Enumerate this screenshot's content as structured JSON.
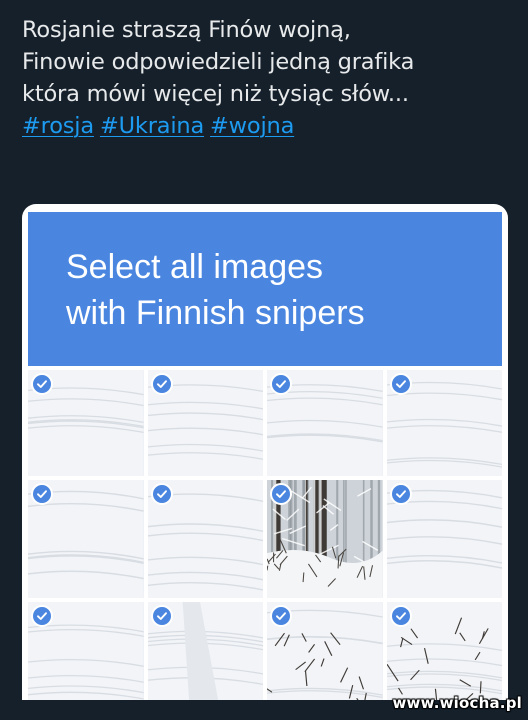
{
  "tweet": {
    "lines": [
      "Rosjanie straszą Finów wojną,",
      "Finowie odpowiedzieli jedną grafika",
      "która mówi więcej niż tysiąc słów..."
    ],
    "hashtags": [
      "#rosja",
      "#Ukraina",
      "#wojna"
    ],
    "link_color": "#1d9bf0"
  },
  "captcha": {
    "title_lines": [
      "Select all images",
      "with Finnish snipers"
    ],
    "header_color": "#4a86e0",
    "tiles": [
      {
        "row": 1,
        "col": 1,
        "scene": "snowy-forest",
        "selected": true
      },
      {
        "row": 1,
        "col": 2,
        "scene": "snowy-forest",
        "selected": true
      },
      {
        "row": 1,
        "col": 3,
        "scene": "snowy-forest",
        "selected": true
      },
      {
        "row": 1,
        "col": 4,
        "scene": "snowy-forest",
        "selected": true
      },
      {
        "row": 2,
        "col": 1,
        "scene": "snowy-forest-edge",
        "selected": true
      },
      {
        "row": 2,
        "col": 2,
        "scene": "snowy-forest-path",
        "selected": true
      },
      {
        "row": 2,
        "col": 3,
        "scene": "snowy-brush",
        "selected": true
      },
      {
        "row": 2,
        "col": 4,
        "scene": "snowy-forest-edge",
        "selected": true
      },
      {
        "row": 3,
        "col": 1,
        "scene": "snow-ground",
        "selected": true
      },
      {
        "row": 3,
        "col": 2,
        "scene": "snow-path",
        "selected": true
      },
      {
        "row": 3,
        "col": 3,
        "scene": "snow-branches",
        "selected": true
      },
      {
        "row": 3,
        "col": 4,
        "scene": "snow-branches",
        "selected": true
      }
    ]
  },
  "watermark": "www.wiocha.pl"
}
